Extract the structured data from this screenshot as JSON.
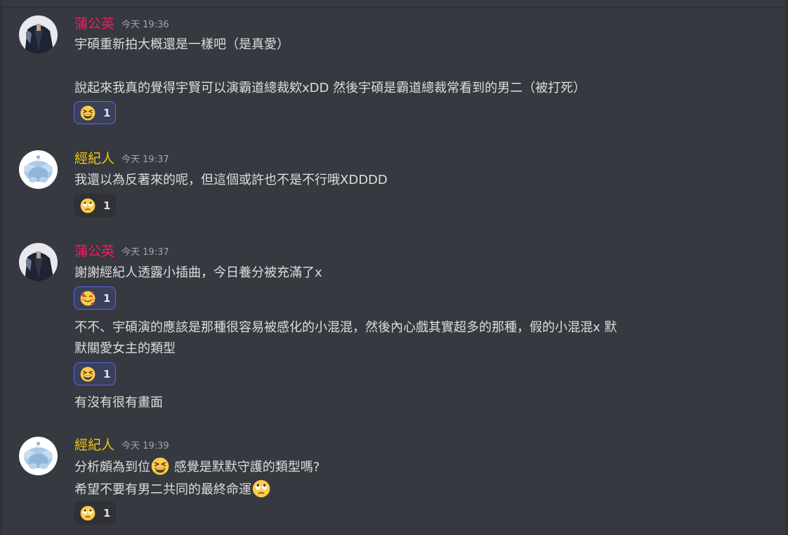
{
  "users": {
    "pugongying": {
      "name": "蒲公英",
      "color": "#e91e63"
    },
    "agent": {
      "name": "經紀人",
      "color": "#f1c40f"
    }
  },
  "messages": [
    {
      "timestamp": "今天 19:36",
      "lines": [
        "宇碩重新拍大概還是一樣吧（是真愛）",
        "說起來我真的覺得宇賢可以演霸道總裁欸xDD 然後宇碩是霸道總裁常看到的男二（被打死）"
      ],
      "reaction": {
        "emoji": "grinning-squinting-face",
        "count": "1",
        "active": true
      }
    },
    {
      "timestamp": "今天 19:37",
      "lines": [
        "我還以為反著來的呢，但這個或許也不是不行哦XDDDD"
      ],
      "reaction": {
        "emoji": "face-with-rolling-eyes",
        "count": "1",
        "active": false
      }
    },
    {
      "timestamp": "今天 19:37",
      "lines": [
        "謝謝經紀人透露小插曲，今日養分被充滿了x",
        "不不、宇碩演的應該是那種很容易被感化的小混混，然後內心戲其實超多的那種，假的小混混x 默",
        "默關愛女主的類型",
        "有沒有很有畫面"
      ],
      "reactions": [
        {
          "emoji": "smiling-face-with-hearts",
          "count": "1",
          "active": true
        },
        {
          "emoji": "grinning-squinting-face",
          "count": "1",
          "active": true
        }
      ]
    },
    {
      "timestamp": "今天 19:39",
      "line1_before": "分析頗為到位",
      "line1_after": " 感覺是默默守護的類型嗎?",
      "line2": "希望不要有男二共同的最終命運",
      "inline_emojis": [
        "grinning-squinting-face",
        "face-with-rolling-eyes"
      ],
      "reaction": {
        "emoji": "face-with-rolling-eyes",
        "count": "1",
        "active": false
      }
    }
  ]
}
